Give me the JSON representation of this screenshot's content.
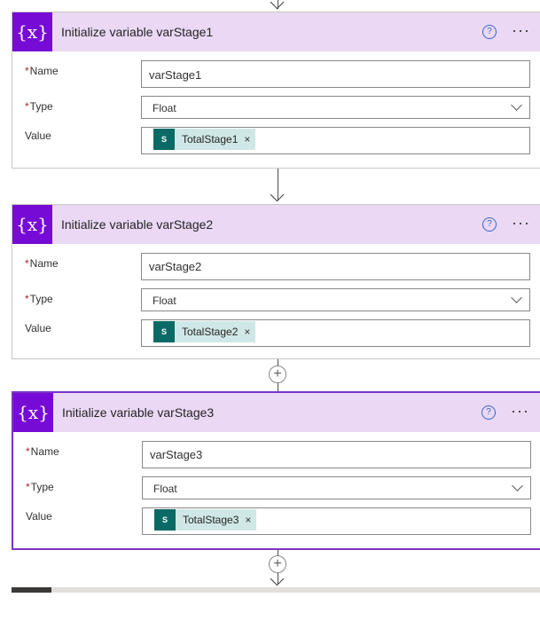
{
  "cards": [
    {
      "title": "Initialize variable varStage1",
      "icon_symbol": "{x}",
      "name_label": "Name",
      "name_value": "varStage1",
      "type_label": "Type",
      "type_value": "Float",
      "value_label": "Value",
      "token_label": "TotalStage1",
      "token_icon": "S"
    },
    {
      "title": "Initialize variable varStage2",
      "icon_symbol": "{x}",
      "name_label": "Name",
      "name_value": "varStage2",
      "type_label": "Type",
      "type_value": "Float",
      "value_label": "Value",
      "token_label": "TotalStage2",
      "token_icon": "S"
    },
    {
      "title": "Initialize variable varStage3",
      "icon_symbol": "{x}",
      "name_label": "Name",
      "name_value": "varStage3",
      "type_label": "Type",
      "type_value": "Float",
      "value_label": "Value",
      "token_label": "TotalStage3",
      "token_icon": "S"
    }
  ],
  "controls": {
    "help_symbol": "?",
    "more_symbol": "···",
    "remove_symbol": "×",
    "required_marker": "*",
    "insert_symbol": "+"
  },
  "colors": {
    "variable_icon_bg": "#770bd6",
    "header_bg": "#ead8f5",
    "selected_border": "#7d32c8",
    "token_bg": "#cfe8e7",
    "sharepoint_icon_bg": "#0b6a66",
    "help_icon": "#3b66c7"
  },
  "icons": [
    "variable-icon",
    "help-icon",
    "more-options-icon",
    "chevron-down-icon",
    "sharepoint-icon",
    "remove-token-icon",
    "add-step-icon",
    "arrow-down-icon"
  ]
}
